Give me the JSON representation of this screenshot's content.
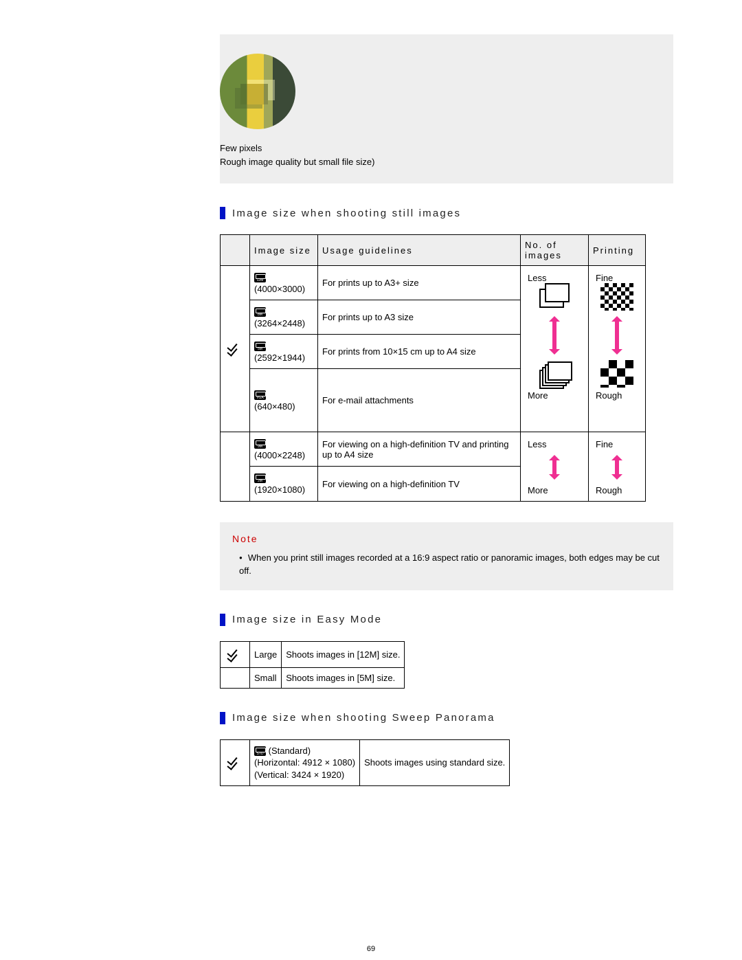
{
  "fewpixels": {
    "l1": "Few pixels",
    "l2": "Rough image quality but small file size)"
  },
  "section1": "Image size when shooting still images",
  "table1": {
    "head": {
      "c1": "Image size",
      "c2": "Usage guidelines",
      "c3": "No. of images",
      "c4": "Printing"
    },
    "r1": {
      "size": "(4000×3000)",
      "usage": "For prints up to A3+ size"
    },
    "r2": {
      "size": "(3264×2448)",
      "usage": "For prints up to A3 size"
    },
    "r3": {
      "size": "(2592×1944)",
      "usage": "For prints from 10×15 cm up to A4 size"
    },
    "r4": {
      "size": "(640×480)",
      "usage": "For e-mail attachments"
    },
    "r5": {
      "size": "(4000×2248)",
      "usage": "For viewing on a high-definition TV and printing up to A4 size"
    },
    "r6": {
      "size": "(1920×1080)",
      "usage": "For viewing on a high-definition TV"
    },
    "labels": {
      "less": "Less",
      "more": "More",
      "fine": "Fine",
      "rough": "Rough"
    }
  },
  "note": {
    "head": "Note",
    "body": "When you print still images recorded at a 16:9 aspect ratio or panoramic images, both edges may be cut off."
  },
  "section2": "Image size in Easy Mode",
  "table2": {
    "r1": {
      "label": "Large",
      "desc": "Shoots images in [12M] size."
    },
    "r2": {
      "label": "Small",
      "desc": "Shoots images in [5M] size."
    }
  },
  "section3": "Image size when shooting Sweep Panorama",
  "table3": {
    "r1": {
      "label": " (Standard)",
      "h": "(Horizontal: 4912 × 1080)",
      "v": "(Vertical: 3424 × 1920)",
      "desc": "Shoots images using standard size."
    }
  },
  "pagenum": "69"
}
